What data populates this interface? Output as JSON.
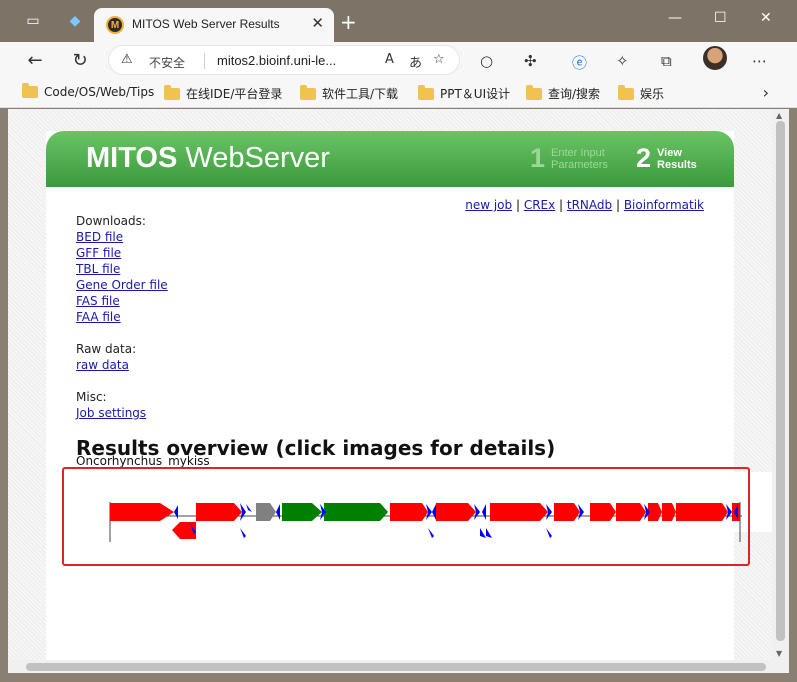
{
  "browser": {
    "tab_title": "MITOS Web Server Results",
    "tab_favicon": "M",
    "address_security": "不安全",
    "address_url": "mitos2.bioinf.uni-le...",
    "bookmarks": [
      "Code/OS/Web/Tips",
      "在线IDE/平台登录",
      "软件工具/下载",
      "PPT＆UI设计",
      "查询/搜索",
      "娱乐"
    ]
  },
  "site": {
    "logo_bold": "MITOS",
    "logo_light": "WebServer",
    "steps": [
      {
        "num": "1",
        "line1": "Enter Input",
        "line2": "Parameters"
      },
      {
        "num": "2",
        "line1": "View",
        "line2": "Results"
      }
    ],
    "top_links": [
      "new job",
      "CREx",
      "tRNAdb",
      "Bioinformatik"
    ],
    "downloads_label": "Downloads:",
    "downloads": [
      "BED file",
      "GFF file",
      "TBL file",
      "Gene Order file",
      "FAS file",
      "FAA file"
    ],
    "raw_label": "Raw data:",
    "raw_link": "raw data",
    "misc_label": "Misc:",
    "misc_link": "Job settings",
    "results_heading": "Results overview (click images for details)",
    "species": "Oncorhynchus_mykiss"
  },
  "colors": {
    "protein": "#ff0000",
    "rrna": "#008000",
    "trna": "#0000ff",
    "other": "#808080",
    "banner": "#4caf50",
    "highlight_box": "#e32222"
  }
}
